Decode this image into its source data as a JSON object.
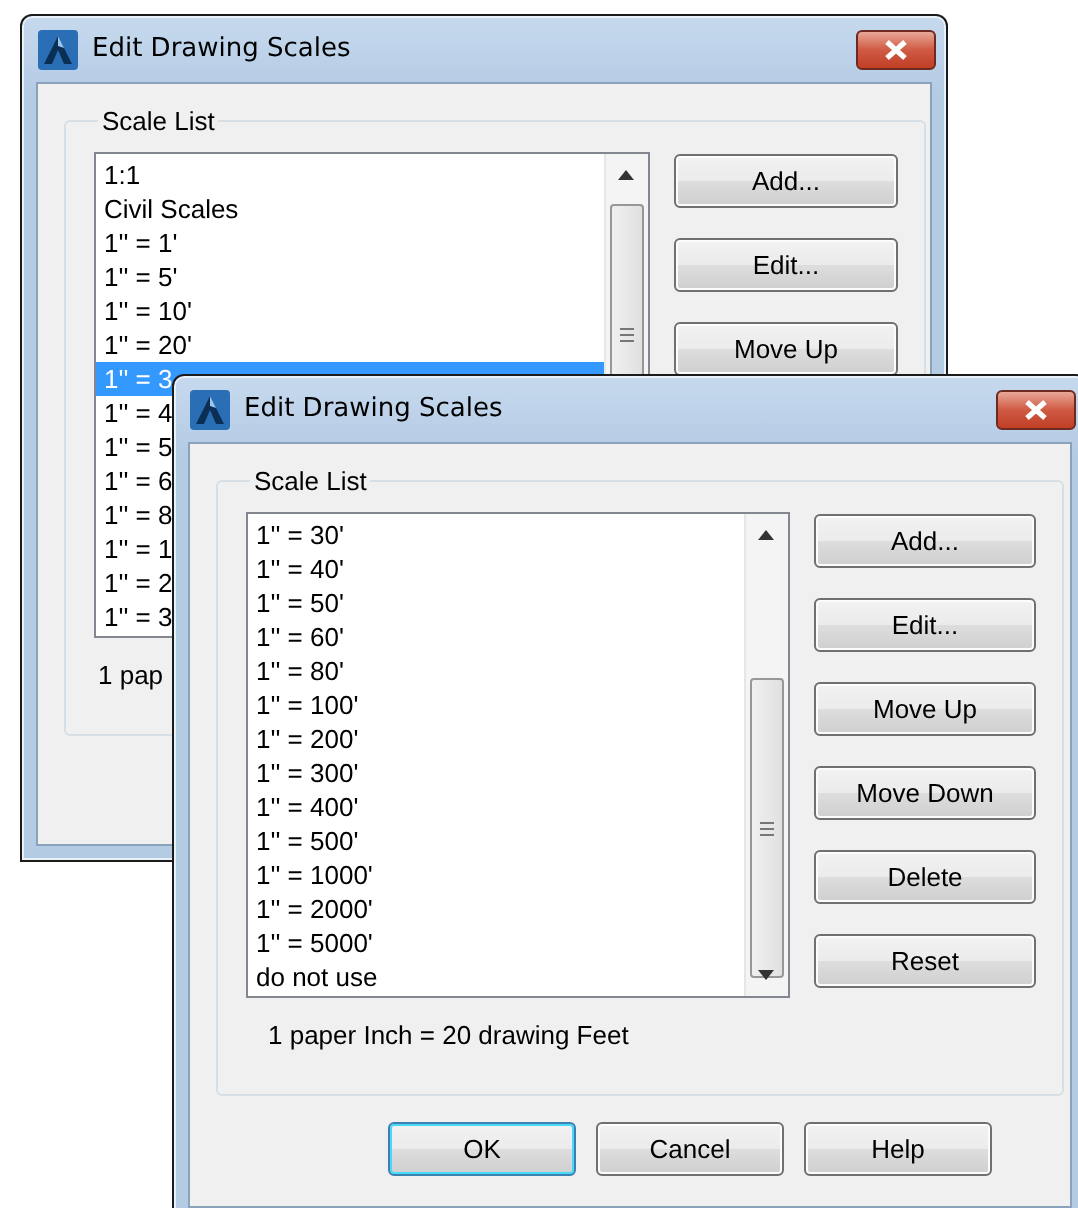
{
  "windows": [
    {
      "title": "Edit Drawing Scales",
      "group": {
        "label": "Scale List",
        "items": [
          {
            "label": "1:1",
            "selected": false
          },
          {
            "label": "Civil Scales",
            "selected": false
          },
          {
            "label": "1'' = 1'",
            "selected": false
          },
          {
            "label": "1'' = 5'",
            "selected": false
          },
          {
            "label": "1'' = 10'",
            "selected": false
          },
          {
            "label": "1'' = 20'",
            "selected": false
          },
          {
            "label": "1'' = 3",
            "selected": true
          },
          {
            "label": "1'' = 4",
            "selected": false
          },
          {
            "label": "1'' = 5",
            "selected": false
          },
          {
            "label": "1'' = 6",
            "selected": false
          },
          {
            "label": "1'' = 8",
            "selected": false
          },
          {
            "label": "1'' = 1",
            "selected": false
          },
          {
            "label": "1'' = 2",
            "selected": false
          },
          {
            "label": "1'' = 3",
            "selected": false
          }
        ],
        "buttons": [
          {
            "label": "Add..."
          },
          {
            "label": "Edit..."
          },
          {
            "label": "Move Up"
          }
        ],
        "caption": "1 pap"
      }
    },
    {
      "title": "Edit Drawing Scales",
      "group": {
        "label": "Scale List",
        "items": [
          {
            "label": "1'' = 30'",
            "selected": false
          },
          {
            "label": "1'' = 40'",
            "selected": false
          },
          {
            "label": "1'' = 50'",
            "selected": false
          },
          {
            "label": "1'' = 60'",
            "selected": false
          },
          {
            "label": "1'' = 80'",
            "selected": false
          },
          {
            "label": "1'' = 100'",
            "selected": false
          },
          {
            "label": "1'' = 200'",
            "selected": false
          },
          {
            "label": "1'' = 300'",
            "selected": false
          },
          {
            "label": "1'' = 400'",
            "selected": false
          },
          {
            "label": "1'' = 500'",
            "selected": false
          },
          {
            "label": "1'' = 1000'",
            "selected": false
          },
          {
            "label": "1'' = 2000'",
            "selected": false
          },
          {
            "label": "1'' = 5000'",
            "selected": false
          },
          {
            "label": "do not use",
            "selected": false
          }
        ],
        "buttons": [
          {
            "label": "Add..."
          },
          {
            "label": "Edit..."
          },
          {
            "label": "Move Up"
          },
          {
            "label": "Move Down"
          },
          {
            "label": "Delete"
          },
          {
            "label": "Reset"
          }
        ],
        "caption": "1 paper Inch = 20 drawing Feet"
      },
      "footer_buttons": [
        {
          "label": "OK",
          "default": true
        },
        {
          "label": "Cancel",
          "default": false
        },
        {
          "label": "Help",
          "default": false
        }
      ]
    }
  ]
}
